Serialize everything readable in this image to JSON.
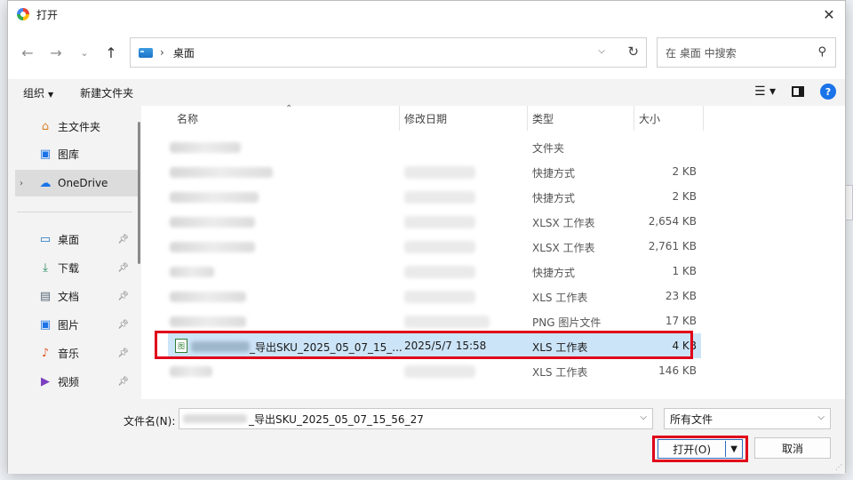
{
  "window": {
    "title": "打开"
  },
  "address": {
    "location": "桌面",
    "separator": "›"
  },
  "search": {
    "placeholder": "在 桌面 中搜索"
  },
  "toolbar": {
    "organize": "组织",
    "new_folder": "新建文件夹"
  },
  "sidebar": {
    "items": [
      {
        "label": "主文件夹",
        "icon": "home-icon"
      },
      {
        "label": "图库",
        "icon": "gallery-icon"
      },
      {
        "label": "OneDrive",
        "icon": "cloud-icon"
      },
      {
        "label": "桌面",
        "icon": "desktop-icon"
      },
      {
        "label": "下载",
        "icon": "download-icon"
      },
      {
        "label": "文档",
        "icon": "document-icon"
      },
      {
        "label": "图片",
        "icon": "pictures-icon"
      },
      {
        "label": "音乐",
        "icon": "music-icon"
      },
      {
        "label": "视频",
        "icon": "video-icon"
      }
    ]
  },
  "columns": {
    "name": "名称",
    "modified": "修改日期",
    "type": "类型",
    "size": "大小"
  },
  "files": [
    {
      "name": "",
      "modified": "",
      "type": "文件夹",
      "size": ""
    },
    {
      "name": "",
      "modified": "",
      "type": "快捷方式",
      "size": "2 KB"
    },
    {
      "name": "",
      "modified": "",
      "type": "快捷方式",
      "size": "2 KB"
    },
    {
      "name": "",
      "modified": "",
      "type": "XLSX 工作表",
      "size": "2,654 KB"
    },
    {
      "name": "",
      "modified": "",
      "type": "XLSX 工作表",
      "size": "2,761 KB"
    },
    {
      "name": "",
      "modified": "",
      "type": "快捷方式",
      "size": "1 KB"
    },
    {
      "name": "",
      "modified": "",
      "type": "XLS 工作表",
      "size": "23 KB"
    },
    {
      "name": "",
      "modified": "",
      "type": "PNG 图片文件",
      "size": "17 KB"
    },
    {
      "name": "_导出SKU_2025_05_07_15_...",
      "modified": "2025/5/7 15:58",
      "type": "XLS 工作表",
      "size": "4 KB"
    },
    {
      "name": "",
      "modified": "",
      "type": "XLS 工作表",
      "size": "146 KB"
    }
  ],
  "filename": {
    "label": "文件名(N):",
    "value": "_导出SKU_2025_05_07_15_56_27"
  },
  "filter": {
    "value": "所有文件"
  },
  "buttons": {
    "open": "打开(O)",
    "cancel": "取消"
  },
  "colors": {
    "selected_row": "#cce4f7",
    "highlight": "#e0001a",
    "accent": "#1a73e8"
  }
}
